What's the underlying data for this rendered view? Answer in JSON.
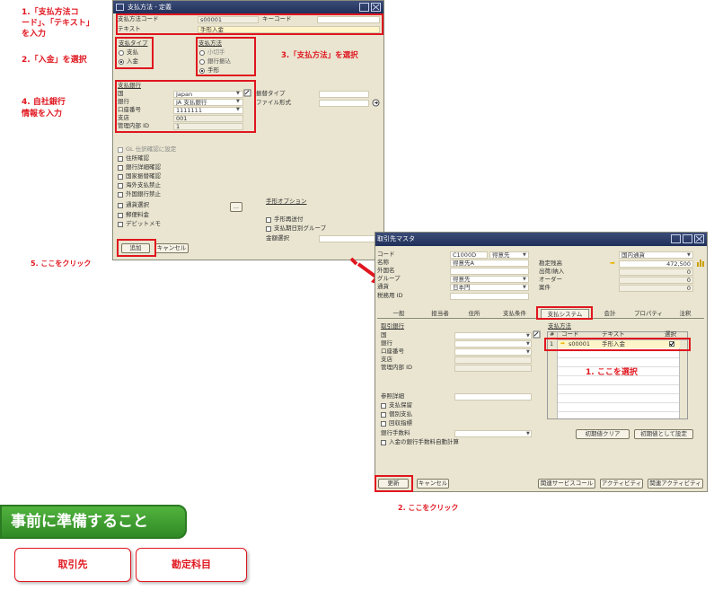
{
  "captions": {
    "c1": "1.「支払方法コ",
    "c1b": "ード」、「テキスト」",
    "c1c": "を入力",
    "c2": "2.「入金」を選択",
    "c3": "3.「支払方法」を選択",
    "c4": "4. 自社銀行",
    "c4b": "情報を入力",
    "c5": "5. ここをクリック",
    "r1": "1. ここを選択",
    "r2": "2. ここをクリック"
  },
  "dialog1": {
    "title": "支払方法 - 定義",
    "code_label": "支払方法コード",
    "code_value": "s00001",
    "key_label": "キーコード",
    "text_label": "テキスト",
    "text_value": "手形入金",
    "type_label": "支払タイプ",
    "type_out": "支払",
    "type_in": "入金",
    "method_label": "支払方法",
    "method_1": "小切手",
    "method_2": "銀行振込",
    "method_3": "手形",
    "bank_label": "支払銀行",
    "country_label": "国",
    "country_value": "Japan",
    "bank_name_label": "銀行",
    "bank_name_value": "JA 支払銀行",
    "account_label": "口座番号",
    "account_value": "1111111",
    "branch_label": "支店",
    "branch_value": "001",
    "inner_label": "管理内部 ID",
    "inner_value": "1",
    "transfer_label": "振替タイプ",
    "file_label": "ファイル形式",
    "check_1": "GL 仕訳確認に設定",
    "check_2": "住所確認",
    "check_3": "銀行詳細確認",
    "check_4": "国家振替確認",
    "check_5": "海外支払禁止",
    "check_6": "外国銀行禁止",
    "check_7": "通貨選択",
    "check_8": "郵便料金",
    "check_9": "デビットメモ",
    "dots": "...",
    "option_label": "手形オプション",
    "opt_1": "手形再送付",
    "opt_2": "支払期日別グループ",
    "amount_label": "金額選択",
    "add_btn": "追加",
    "cancel_btn": "キャンセル"
  },
  "dialog2": {
    "title": "取引先マスタ",
    "code_label": "コード",
    "code_value": "C1000D",
    "code_type": "得意先",
    "name_label": "名称",
    "name_value": "得意先A",
    "foreign_label": "外国名",
    "group_label": "グループ",
    "group_value": "得意先",
    "currency_label": "通貨",
    "currency_value": "日本円",
    "tax_label": "税務用 ID",
    "right_top": "国内通貨",
    "balance_label": "勘定残高",
    "balance_value": "472,500",
    "shipping_label": "出荷/納入",
    "shipping_value": "0",
    "order_label": "オーダー",
    "order_value": "0",
    "opp_label": "案件",
    "opp_value": "0",
    "tabs": [
      "一般",
      "担当者",
      "住所",
      "支払条件",
      "支払システム",
      "会計",
      "プロパティ",
      "注釈"
    ],
    "bank_label": "取引銀行",
    "country_label": "国",
    "bank_name_label": "銀行",
    "account_label": "口座番号",
    "branch_label": "支店",
    "inner_label": "管理内部 ID",
    "ref_label": "参照詳細",
    "chk_1": "支払保留",
    "chk_2": "個別支払",
    "chk_3": "回収指標",
    "fee_label": "銀行手数料",
    "chk_4": "入金の銀行手数料自動計算",
    "pm_label": "支払方法",
    "col_no": "#",
    "col_code": "コード",
    "col_text": "テキスト",
    "col_sel": "選択",
    "row_no": "1",
    "row_code": "s00001",
    "row_text": "手形入金",
    "clear_btn": "初期値クリア",
    "set_btn": "初期値として設定",
    "update_btn": "更新",
    "cancel_btn": "キャンセル",
    "svc_btn": "関連サービスコール",
    "act_btn": "アクティビティ",
    "act2_btn": "関連アクティビティ"
  },
  "bottom": {
    "heading": "事前に準備すること",
    "btn_1": "取引先",
    "btn_2": "勘定科目"
  }
}
